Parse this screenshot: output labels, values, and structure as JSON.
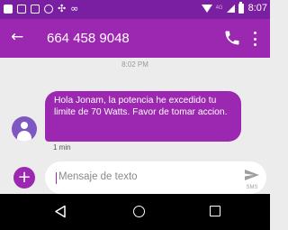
{
  "status_bar": {
    "time": "8:07",
    "network": "4G",
    "icons": [
      "notification-icon",
      "photo-icon",
      "chat-icon",
      "whatsapp-icon",
      "puzzle-icon",
      "voicemail-icon",
      "wifi-icon",
      "signal-icon",
      "battery-icon"
    ]
  },
  "header": {
    "back_glyph": "←",
    "title": "664 458 9048",
    "icons": [
      "back-arrow-icon",
      "phone-icon",
      "more-vert-icon"
    ]
  },
  "conversation": {
    "timestamp": "8:02 PM",
    "message": {
      "text": "Hola Jonam, la potencia he excedido tu limite de 70 Watts. Favor de tomar accion.",
      "time": "1 min"
    }
  },
  "composer": {
    "add_glyph": "+",
    "placeholder": "Mensaje de texto",
    "send_label": "SMS"
  },
  "nav": {
    "icons": [
      "nav-back-icon",
      "nav-home-icon",
      "nav-recents-icon"
    ]
  },
  "colors": {
    "status_bar": "#7b1fa2",
    "app_bar": "#9c27b0",
    "bubble": "#9c27b0",
    "background": "#ececec",
    "nav_bar": "#000000"
  }
}
